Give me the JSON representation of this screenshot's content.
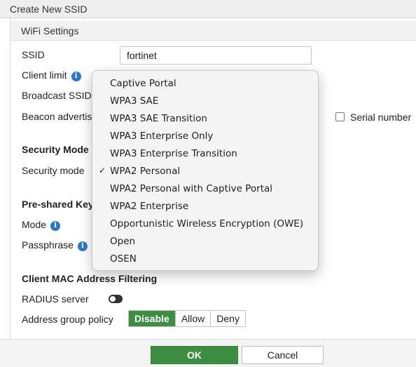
{
  "dialog": {
    "title": "Create New SSID"
  },
  "wifi_settings": {
    "section_title": "WiFi Settings",
    "ssid_label": "SSID",
    "ssid_value": "fortinet",
    "client_limit_label": "Client limit",
    "broadcast_ssid_label": "Broadcast SSID",
    "beacon_label": "Beacon advertis",
    "serial_number_label": "Serial number"
  },
  "security": {
    "section_title": "Security Mode S",
    "mode_label": "Security mode"
  },
  "preshared": {
    "section_title": "Pre-shared Key",
    "mode_label": "Mode",
    "passphrase_label": "Passphrase"
  },
  "mac_filter": {
    "section_title": "Client MAC Address Filtering",
    "radius_label": "RADIUS server",
    "address_group_label": "Address group policy",
    "options": [
      "Disable",
      "Allow",
      "Deny"
    ],
    "selected": "Disable"
  },
  "dropdown": {
    "items": [
      "Captive Portal",
      "WPA3 SAE",
      "WPA3 SAE Transition",
      "WPA3 Enterprise Only",
      "WPA3 Enterprise Transition",
      "WPA2 Personal",
      "WPA2 Personal with Captive Portal",
      "WPA2 Enterprise",
      "Opportunistic Wireless Encryption (OWE)",
      "Open",
      "OSEN"
    ],
    "selected": "WPA2 Personal",
    "check_glyph": "✓"
  },
  "footer": {
    "ok_label": "OK",
    "cancel_label": "Cancel"
  },
  "colors": {
    "accent": "#3e8e41",
    "info": "#2b78c6"
  },
  "icons": {
    "info": "i"
  }
}
